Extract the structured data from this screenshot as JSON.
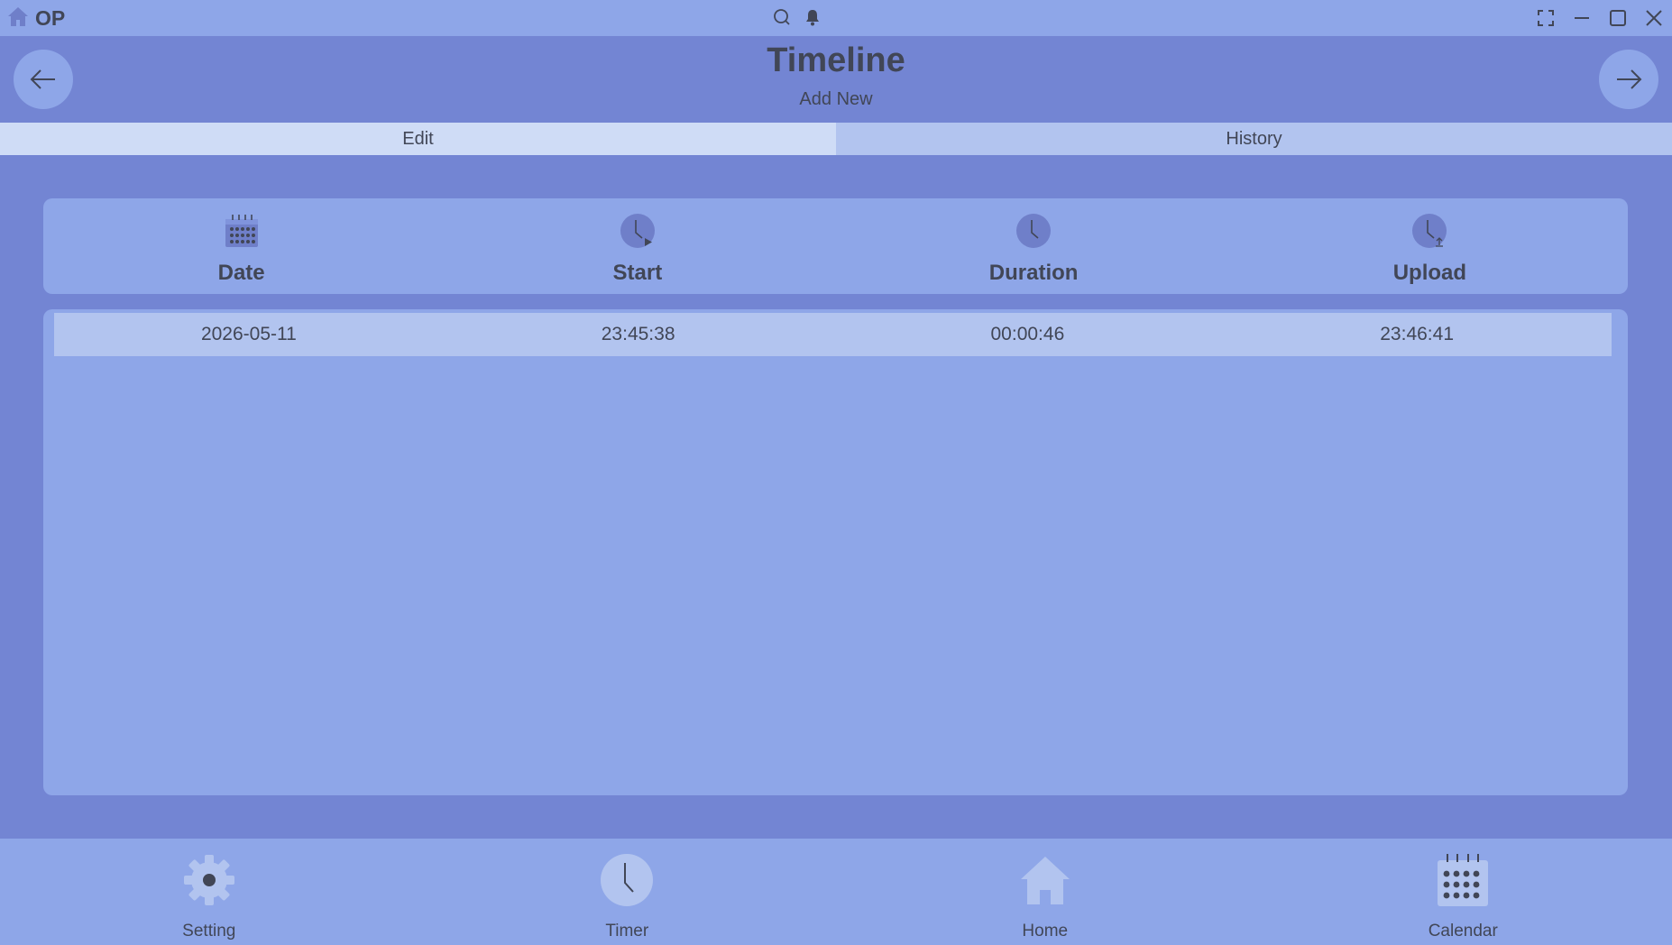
{
  "titlebar": {
    "app_name": "OP",
    "icons": [
      "home-icon",
      "search-icon",
      "bell-icon",
      "fullscreen-icon",
      "minimize-icon",
      "maximize-icon",
      "close-icon"
    ]
  },
  "header": {
    "title": "Timeline",
    "subtitle": "Add New"
  },
  "tabs": [
    {
      "label": "Edit",
      "active": true
    },
    {
      "label": "History",
      "active": false
    }
  ],
  "columns": [
    {
      "label": "Date",
      "icon": "calendar-icon"
    },
    {
      "label": "Start",
      "icon": "clock-play-icon"
    },
    {
      "label": "Duration",
      "icon": "clock-icon"
    },
    {
      "label": "Upload",
      "icon": "clock-upload-icon"
    }
  ],
  "rows": [
    {
      "date": "2026-05-11",
      "start": "23:45:38",
      "duration": "00:00:46",
      "upload": "23:46:41"
    }
  ],
  "bottom_nav": [
    {
      "label": "Setting",
      "icon": "gear-icon"
    },
    {
      "label": "Timer",
      "icon": "clock-icon"
    },
    {
      "label": "Home",
      "icon": "home-icon"
    },
    {
      "label": "Calendar",
      "icon": "calendar-icon"
    }
  ],
  "colors": {
    "background": "#7385d3",
    "panel": "#8ea6e8",
    "row_highlight": "#b2c4ef",
    "tab_active": "#cfdcf6",
    "text": "#414656"
  }
}
